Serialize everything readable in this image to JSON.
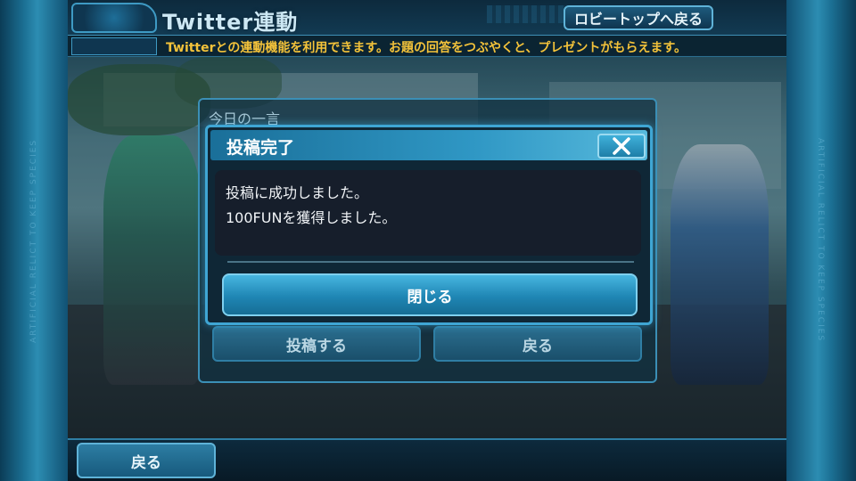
{
  "header": {
    "title": "Twitter連動",
    "lobby_button": "ロビートップへ戻る",
    "description": "Twitterとの連動機能を利用できます。お題の回答をつぶやくと、プレゼントがもらえます。"
  },
  "panel": {
    "title": "今日の一言",
    "post_button": "投稿する",
    "back_button": "戻る"
  },
  "modal": {
    "title": "投稿完了",
    "message_lines": [
      "投稿に成功しました。",
      "100FUNを獲得しました。"
    ],
    "close_button": "閉じる",
    "close_icon": "close-icon"
  },
  "footer": {
    "back_button": "戻る"
  },
  "colors": {
    "accent": "#3fa6d4",
    "description_text": "#f3c23a",
    "modal_bg": "#0f2736",
    "message_bg": "#161e2b"
  }
}
